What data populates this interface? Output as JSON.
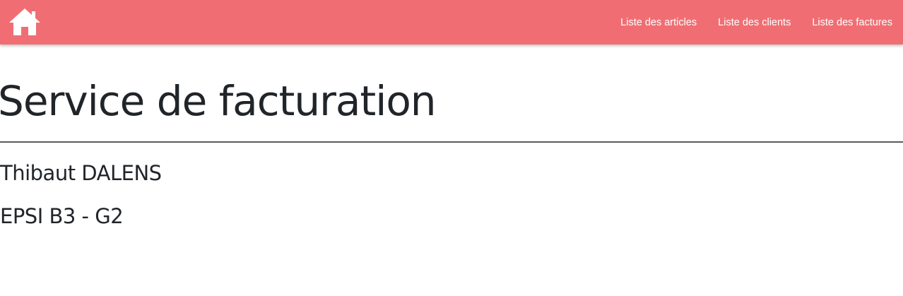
{
  "navbar": {
    "background": "#f06e73",
    "home_icon": "home-icon",
    "links": [
      {
        "label": "Liste des articles"
      },
      {
        "label": "Liste des clients"
      },
      {
        "label": "Liste des factures"
      }
    ]
  },
  "main": {
    "title": "Service de facturation",
    "author": "Thibaut DALENS",
    "group": "EPSI B3 - G2"
  }
}
